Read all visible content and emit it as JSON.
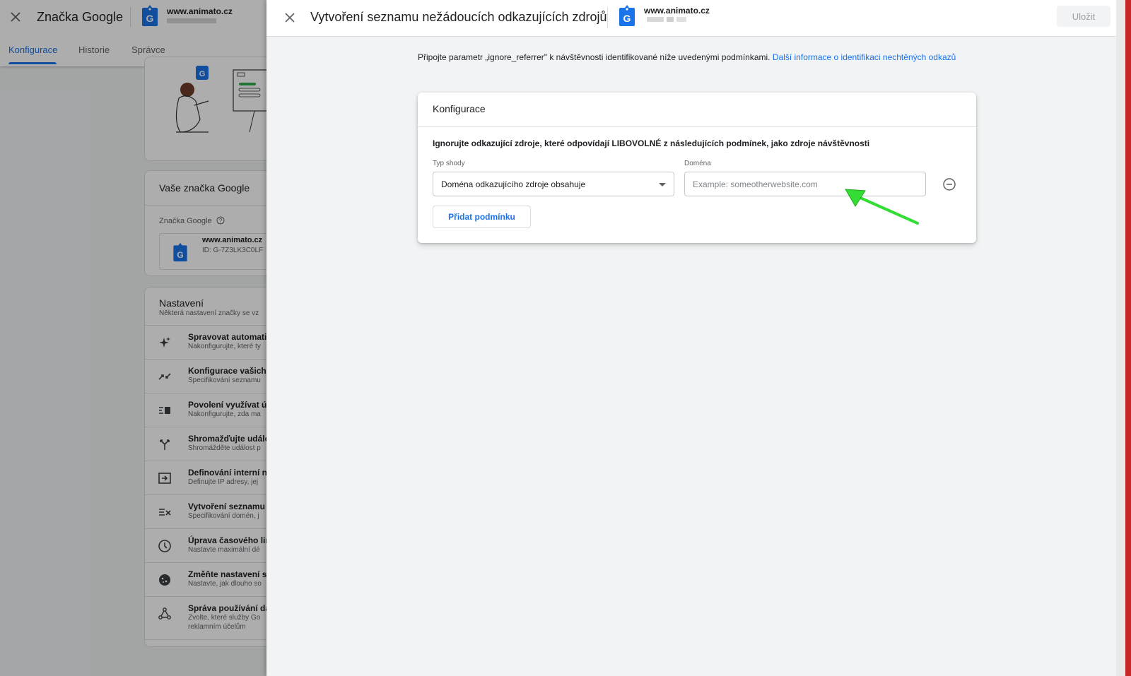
{
  "background": {
    "title": "Značka Google",
    "domain": "www.animato.cz",
    "tabs": [
      {
        "label": "Konfigurace",
        "active": true
      },
      {
        "label": "Historie",
        "active": false
      },
      {
        "label": "Správce",
        "active": false
      }
    ],
    "tag_card": {
      "title": "Vaše značka Google",
      "label": "Značka Google",
      "domain": "www.animato.cz",
      "id": "ID: G-7Z3LK3C0LF"
    },
    "settings": {
      "title": "Nastavení",
      "subtitle": "Některá nastavení značky se vz",
      "items": [
        {
          "icon": "sparkle-icon",
          "title": "Spravovat automatic",
          "desc": "Nakonfigurujte, které ty"
        },
        {
          "icon": "merge-icon",
          "title": "Konfigurace vašich",
          "desc": "Specifikování seznamu"
        },
        {
          "icon": "user-data-icon",
          "title": "Povolení využívat ú",
          "desc": "Nakonfigurujte, zda ma"
        },
        {
          "icon": "fork-icon",
          "title": "Shromažďujte událo",
          "desc": "Shromážděte událost p"
        },
        {
          "icon": "login-icon",
          "title": "Definování interní n",
          "desc": "Definujte IP adresy, jej"
        },
        {
          "icon": "filter-list-icon",
          "title": "Vytvoření seznamu",
          "desc": "Specifikování domén, j"
        },
        {
          "icon": "clock-icon",
          "title": "Úprava časového lim",
          "desc": "Nastavte maximální dé"
        },
        {
          "icon": "cookie-icon",
          "title": "Změňte nastavení s",
          "desc": "Nastavte, jak dlouho so"
        },
        {
          "icon": "data-sharing-icon",
          "title": "Správa používání da",
          "desc": "Zvolte, které služby Go",
          "desc2": "reklamním účelům"
        }
      ]
    }
  },
  "drawer": {
    "title": "Vytvoření seznamu nežádoucích odkazujících zdrojů",
    "domain": "www.animato.cz",
    "save_label": "Uložit",
    "intro_text": "Připojte parametr „ignore_referrer\" k návštěvnosti identifikované níže uvedenými podmínkami.",
    "intro_link": "Další informace o identifikaci nechtěných odkazů",
    "config": {
      "title": "Konfigurace",
      "rule_text": "Ignorujte odkazující zdroje, které odpovídají LIBOVOLNÉ z následujících podmínek, jako zdroje návštěvnosti",
      "match_type_label": "Typ shody",
      "match_type_value": "Doména odkazujícího zdroje obsahuje",
      "domain_label": "Doména",
      "domain_value": "",
      "domain_placeholder": "Example: someotherwebsite.com",
      "add_condition_label": "Přidat podmínku"
    }
  },
  "colors": {
    "accent": "#1a73e8",
    "annotation_arrow": "#33dd33",
    "edge_red": "#c62828"
  }
}
